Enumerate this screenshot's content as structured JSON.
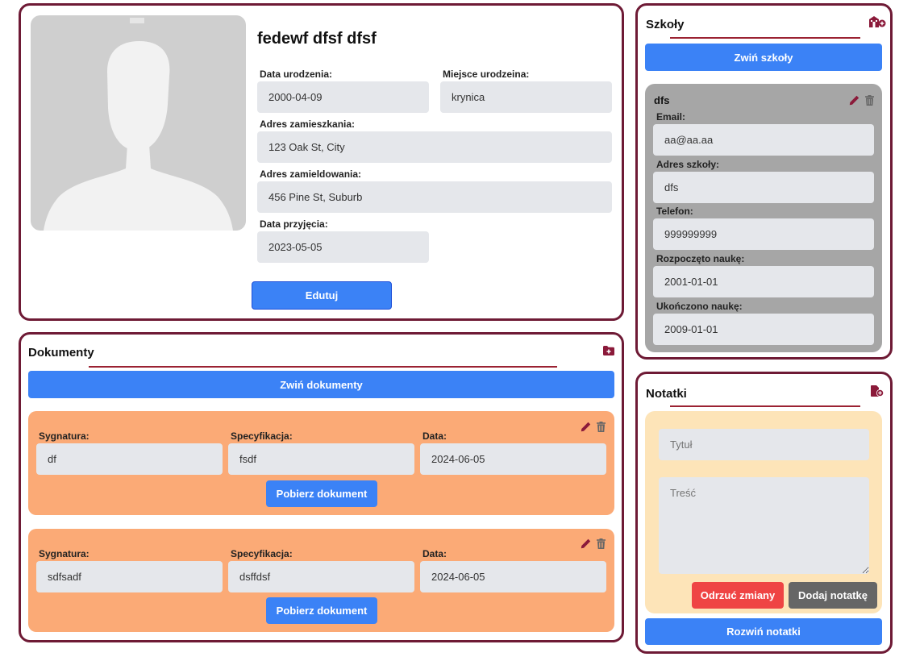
{
  "profile": {
    "name": "fedewf dfsf dfsf",
    "fields": {
      "birth_date": {
        "label": "Data urodzenia:",
        "value": "2000-04-09"
      },
      "birth_place": {
        "label": "Miejsce urodzeina:",
        "value": "krynica"
      },
      "address": {
        "label": "Adres zamieszkania:",
        "value": "123 Oak St, City"
      },
      "registered_address": {
        "label": "Adres zamieldowania:",
        "value": "456 Pine St, Suburb"
      },
      "admission_date": {
        "label": "Data przyjęcia:",
        "value": "2023-05-05"
      }
    },
    "edit_label": "Edutuj"
  },
  "documents": {
    "title": "Dokumenty",
    "collapse_label": "Zwiń dokumenty",
    "items": [
      {
        "signature_label": "Sygnatura:",
        "signature": "df",
        "spec_label": "Specyfikacja:",
        "spec": "fsdf",
        "date_label": "Data:",
        "date": "2024-06-05",
        "download_label": "Pobierz dokument"
      },
      {
        "signature_label": "Sygnatura:",
        "signature": "sdfsadf",
        "spec_label": "Specyfikacja:",
        "spec": "dsffdsf",
        "date_label": "Data:",
        "date": "2024-06-05",
        "download_label": "Pobierz dokument"
      }
    ]
  },
  "schools": {
    "title": "Szkoły",
    "collapse_label": "Zwiń szkoły",
    "items": [
      {
        "name": "dfs",
        "email_label": "Email:",
        "email": "aa@aa.aa",
        "address_label": "Adres szkoły:",
        "address": "dfs",
        "phone_label": "Telefon:",
        "phone": "999999999",
        "start_label": "Rozpoczęto naukę:",
        "start": "2001-01-01",
        "end_label": "Ukończono naukę:",
        "end": "2009-01-01"
      }
    ]
  },
  "notes": {
    "title": "Notatki",
    "title_placeholder": "Tytuł",
    "content_placeholder": "Treść",
    "discard_label": "Odrzuć zmiany",
    "add_label": "Dodaj notatkę",
    "expand_label": "Rozwiń notatki"
  },
  "colors": {
    "panel_border": "#6e1a35",
    "accent_blue": "#3b82f6",
    "document_card": "#fbaa76",
    "school_card": "#a6a6a6",
    "note_card": "#fde4b8",
    "discard_red": "#ef4444",
    "add_gray": "#666666",
    "icon_maroon": "#8b1a3a"
  },
  "icons": [
    "school-add-icon",
    "folder-add-icon",
    "file-add-icon",
    "pencil-icon",
    "trash-icon",
    "avatar-placeholder"
  ]
}
